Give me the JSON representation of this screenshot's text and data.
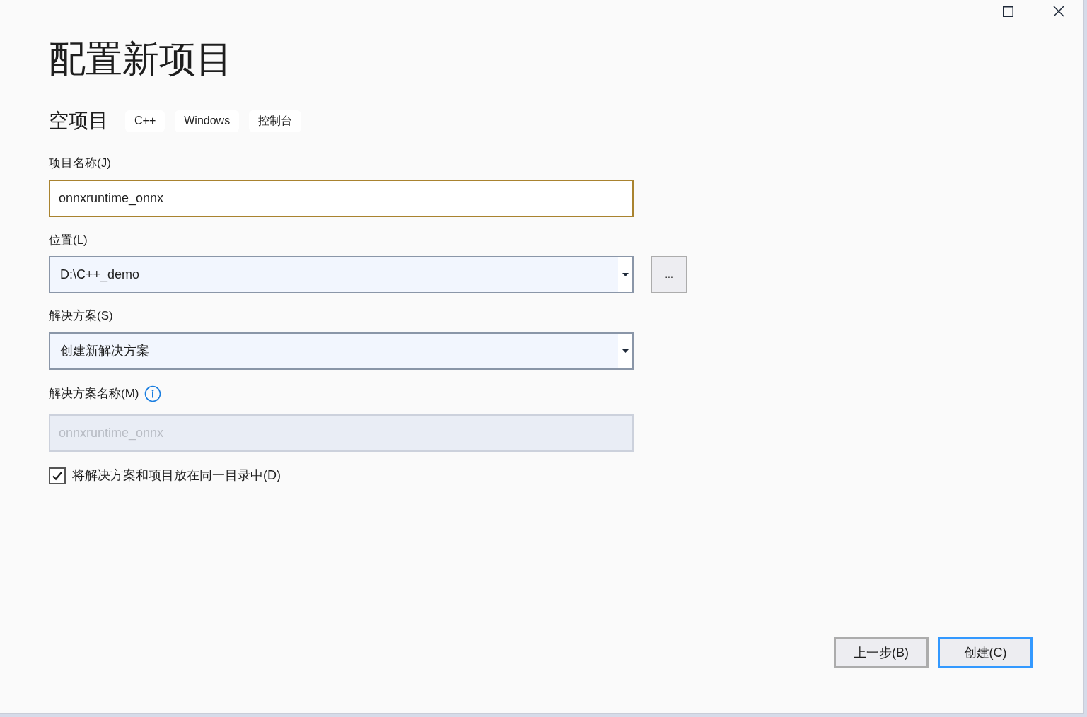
{
  "window": {
    "title": "配置新项目"
  },
  "template": {
    "name": "空项目",
    "tags": [
      "C++",
      "Windows",
      "控制台"
    ]
  },
  "project_name": {
    "label": "项目名称(J)",
    "value": "onnxruntime_onnx",
    "focused": true
  },
  "location": {
    "label": "位置(L)",
    "value": "D:\\C++_demo",
    "browse": "..."
  },
  "solution": {
    "label": "解决方案(S)",
    "value": "创建新解决方案"
  },
  "solution_name": {
    "label": "解决方案名称(M)",
    "value": "onnxruntime_onnx",
    "disabled": true
  },
  "same_directory": {
    "label": "将解决方案和项目放在同一目录中(D)",
    "checked": true
  },
  "buttons": [
    {
      "label": "上一步(B)",
      "primary": false
    },
    {
      "label": "创建(C)",
      "primary": true
    }
  ]
}
